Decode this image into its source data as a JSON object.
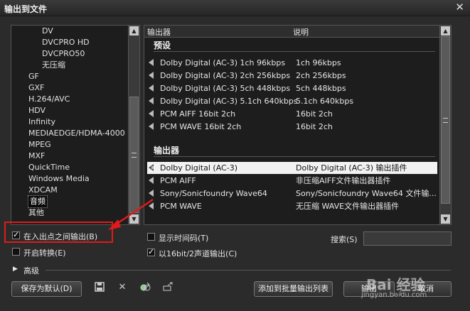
{
  "window": {
    "title": "输出到文件",
    "close_glyph": "✕"
  },
  "tree": {
    "items": [
      {
        "label": "DV",
        "indent": 2
      },
      {
        "label": "DVCPRO HD",
        "indent": 2
      },
      {
        "label": "DVCPRO50",
        "indent": 2
      },
      {
        "label": "无压缩",
        "indent": 2
      },
      {
        "label": "GF",
        "indent": 1
      },
      {
        "label": "GXF",
        "indent": 1
      },
      {
        "label": "H.264/AVC",
        "indent": 1
      },
      {
        "label": "HDV",
        "indent": 1
      },
      {
        "label": "Infinity",
        "indent": 1
      },
      {
        "label": "MEDIAEDGE/HDMA-4000",
        "indent": 1
      },
      {
        "label": "MPEG",
        "indent": 1
      },
      {
        "label": "MXF",
        "indent": 1
      },
      {
        "label": "QuickTime",
        "indent": 1
      },
      {
        "label": "Windows Media",
        "indent": 1
      },
      {
        "label": "XDCAM",
        "indent": 1
      },
      {
        "label": "音频",
        "indent": 1,
        "selected": true
      },
      {
        "label": "其他",
        "indent": 1
      }
    ]
  },
  "exporters": {
    "col_exporter": "输出器",
    "col_desc": "说明",
    "presets_title": "预设",
    "presets": [
      {
        "name": "Dolby Digital (AC-3) 1ch 96kbps",
        "desc": "1ch 96kbps"
      },
      {
        "name": "Dolby Digital (AC-3) 2ch 256kbps",
        "desc": "2ch 256kbps"
      },
      {
        "name": "Dolby Digital (AC-3) 5ch 448kbps",
        "desc": "5ch 448kbps"
      },
      {
        "name": "Dolby Digital (AC-3) 5.1ch 640kbps",
        "desc": "5.1ch 640kbps"
      },
      {
        "name": "PCM AIFF 16bit 2ch",
        "desc": "16bit 2ch"
      },
      {
        "name": "PCM WAVE 16bit 2ch",
        "desc": "16bit 2ch"
      }
    ],
    "exporters_title": "输出器",
    "list": [
      {
        "name": "Dolby Digital (AC-3)",
        "desc": "Dolby Digital (AC-3) 输出插件",
        "selected": true
      },
      {
        "name": "PCM AIFF",
        "desc": "非压缩AIFF文件输出器插件"
      },
      {
        "name": "Sony/Sonicfoundry Wave64",
        "desc": "Sony/Sonicfoundry Wave64 文件输..."
      },
      {
        "name": "PCM WAVE",
        "desc": "无压缩 WAVE文件输出器插件"
      }
    ]
  },
  "options": {
    "inout_label": "在入出点之间输出(B)",
    "inout_checked": true,
    "convert_label": "开启转换(E)",
    "convert_checked": false,
    "timecode_label": "显示时间码(T)",
    "timecode_checked": false,
    "bit16_label": "以16bit/2声道输出(C)",
    "bit16_checked": true,
    "search_label": "搜索(S)",
    "search_value": ""
  },
  "advanced_label": "高级",
  "buttons": {
    "save_default": "保存为默认(D)",
    "add_batch": "添加到批量输出列表",
    "output": "输出",
    "cancel": "取消"
  },
  "watermark": {
    "main": "Bai 经验",
    "sub": "jingyan.baidu.com"
  },
  "colors": {
    "highlight": "#e21a1a",
    "selection": "#f2f2f2"
  }
}
